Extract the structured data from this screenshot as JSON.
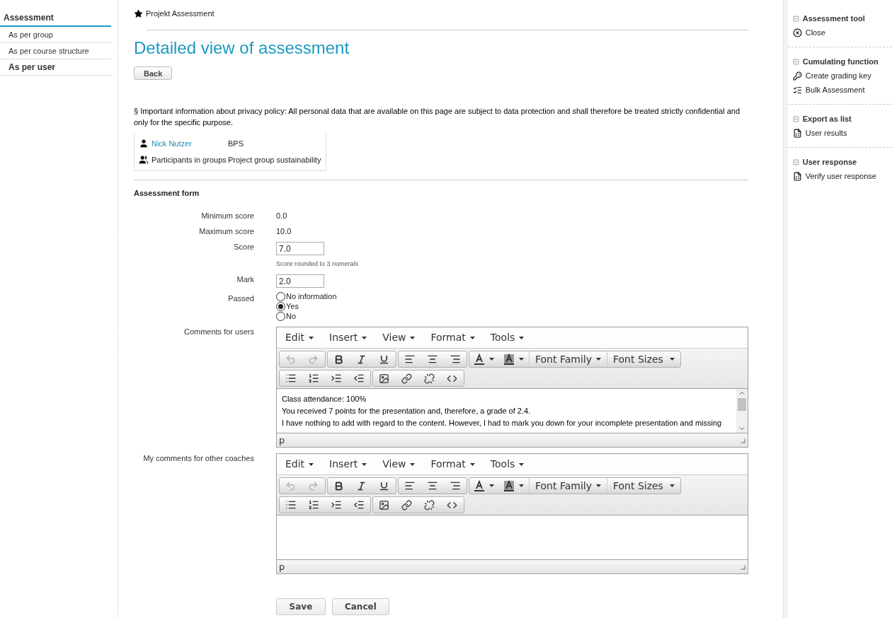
{
  "left_nav": {
    "title": "Assessment",
    "items": [
      {
        "label": "As per group",
        "selected": false
      },
      {
        "label": "As per course structure",
        "selected": false
      },
      {
        "label": "As per user",
        "selected": true
      }
    ]
  },
  "breadcrumb": "Projekt Assessment",
  "page_title": "Detailed view of assessment",
  "back_button": "Back",
  "privacy_notice": "§ Important information about privacy policy: All personal data that are available on this page are subject to data protection and shall therefore be treated strictly confidential and only for the specific purpose.",
  "identity": {
    "user_name": "Nick Nutzer",
    "user_value": "BPS",
    "groups_label": "Participants in groups",
    "groups_value": "Project group sustainability"
  },
  "form": {
    "title": "Assessment form",
    "minimum_score": {
      "label": "Minimum score",
      "value": "0.0"
    },
    "maximum_score": {
      "label": "Maximum score",
      "value": "10.0"
    },
    "score": {
      "label": "Score",
      "value": "7.0",
      "hint": "Score rounded to 3 numerals"
    },
    "mark": {
      "label": "Mark",
      "value": "2.0"
    },
    "passed": {
      "label": "Passed",
      "options": [
        {
          "label": "No information",
          "selected": false
        },
        {
          "label": "Yes",
          "selected": true
        },
        {
          "label": "No",
          "selected": false
        }
      ]
    },
    "editors": [
      {
        "label": "Comments for users",
        "menus": [
          "Edit",
          "Insert",
          "View",
          "Format",
          "Tools"
        ],
        "font_family": "Font Family",
        "font_sizes": "Font Sizes",
        "undo_disabled": true,
        "redo_disabled": true,
        "content": [
          "Class attendance: 100%",
          "You received 7 points for the presentation and, therefore, a grade of 2.4.",
          "I have nothing to add with regard to the content. However, I had to mark you down for your incomplete presentation and missing"
        ],
        "path": "p",
        "scrollbar": true
      },
      {
        "label": "My comments for other coaches",
        "menus": [
          "Edit",
          "Insert",
          "View",
          "Format",
          "Tools"
        ],
        "font_family": "Font Family",
        "font_sizes": "Font Sizes",
        "undo_disabled": true,
        "redo_disabled": true,
        "path": "p",
        "scrollbar": false
      }
    ],
    "buttons": [
      "Save",
      "Cancel"
    ]
  },
  "right_panel": [
    {
      "title": "Assessment tool",
      "items": [
        "Close"
      ]
    },
    {
      "title": "Cumulating function",
      "items": [
        "Create grading key",
        "Bulk Assessment"
      ]
    },
    {
      "title": "Export as list",
      "items": [
        "User results"
      ]
    },
    {
      "title": "User response",
      "items": [
        "Verify user response"
      ]
    }
  ]
}
